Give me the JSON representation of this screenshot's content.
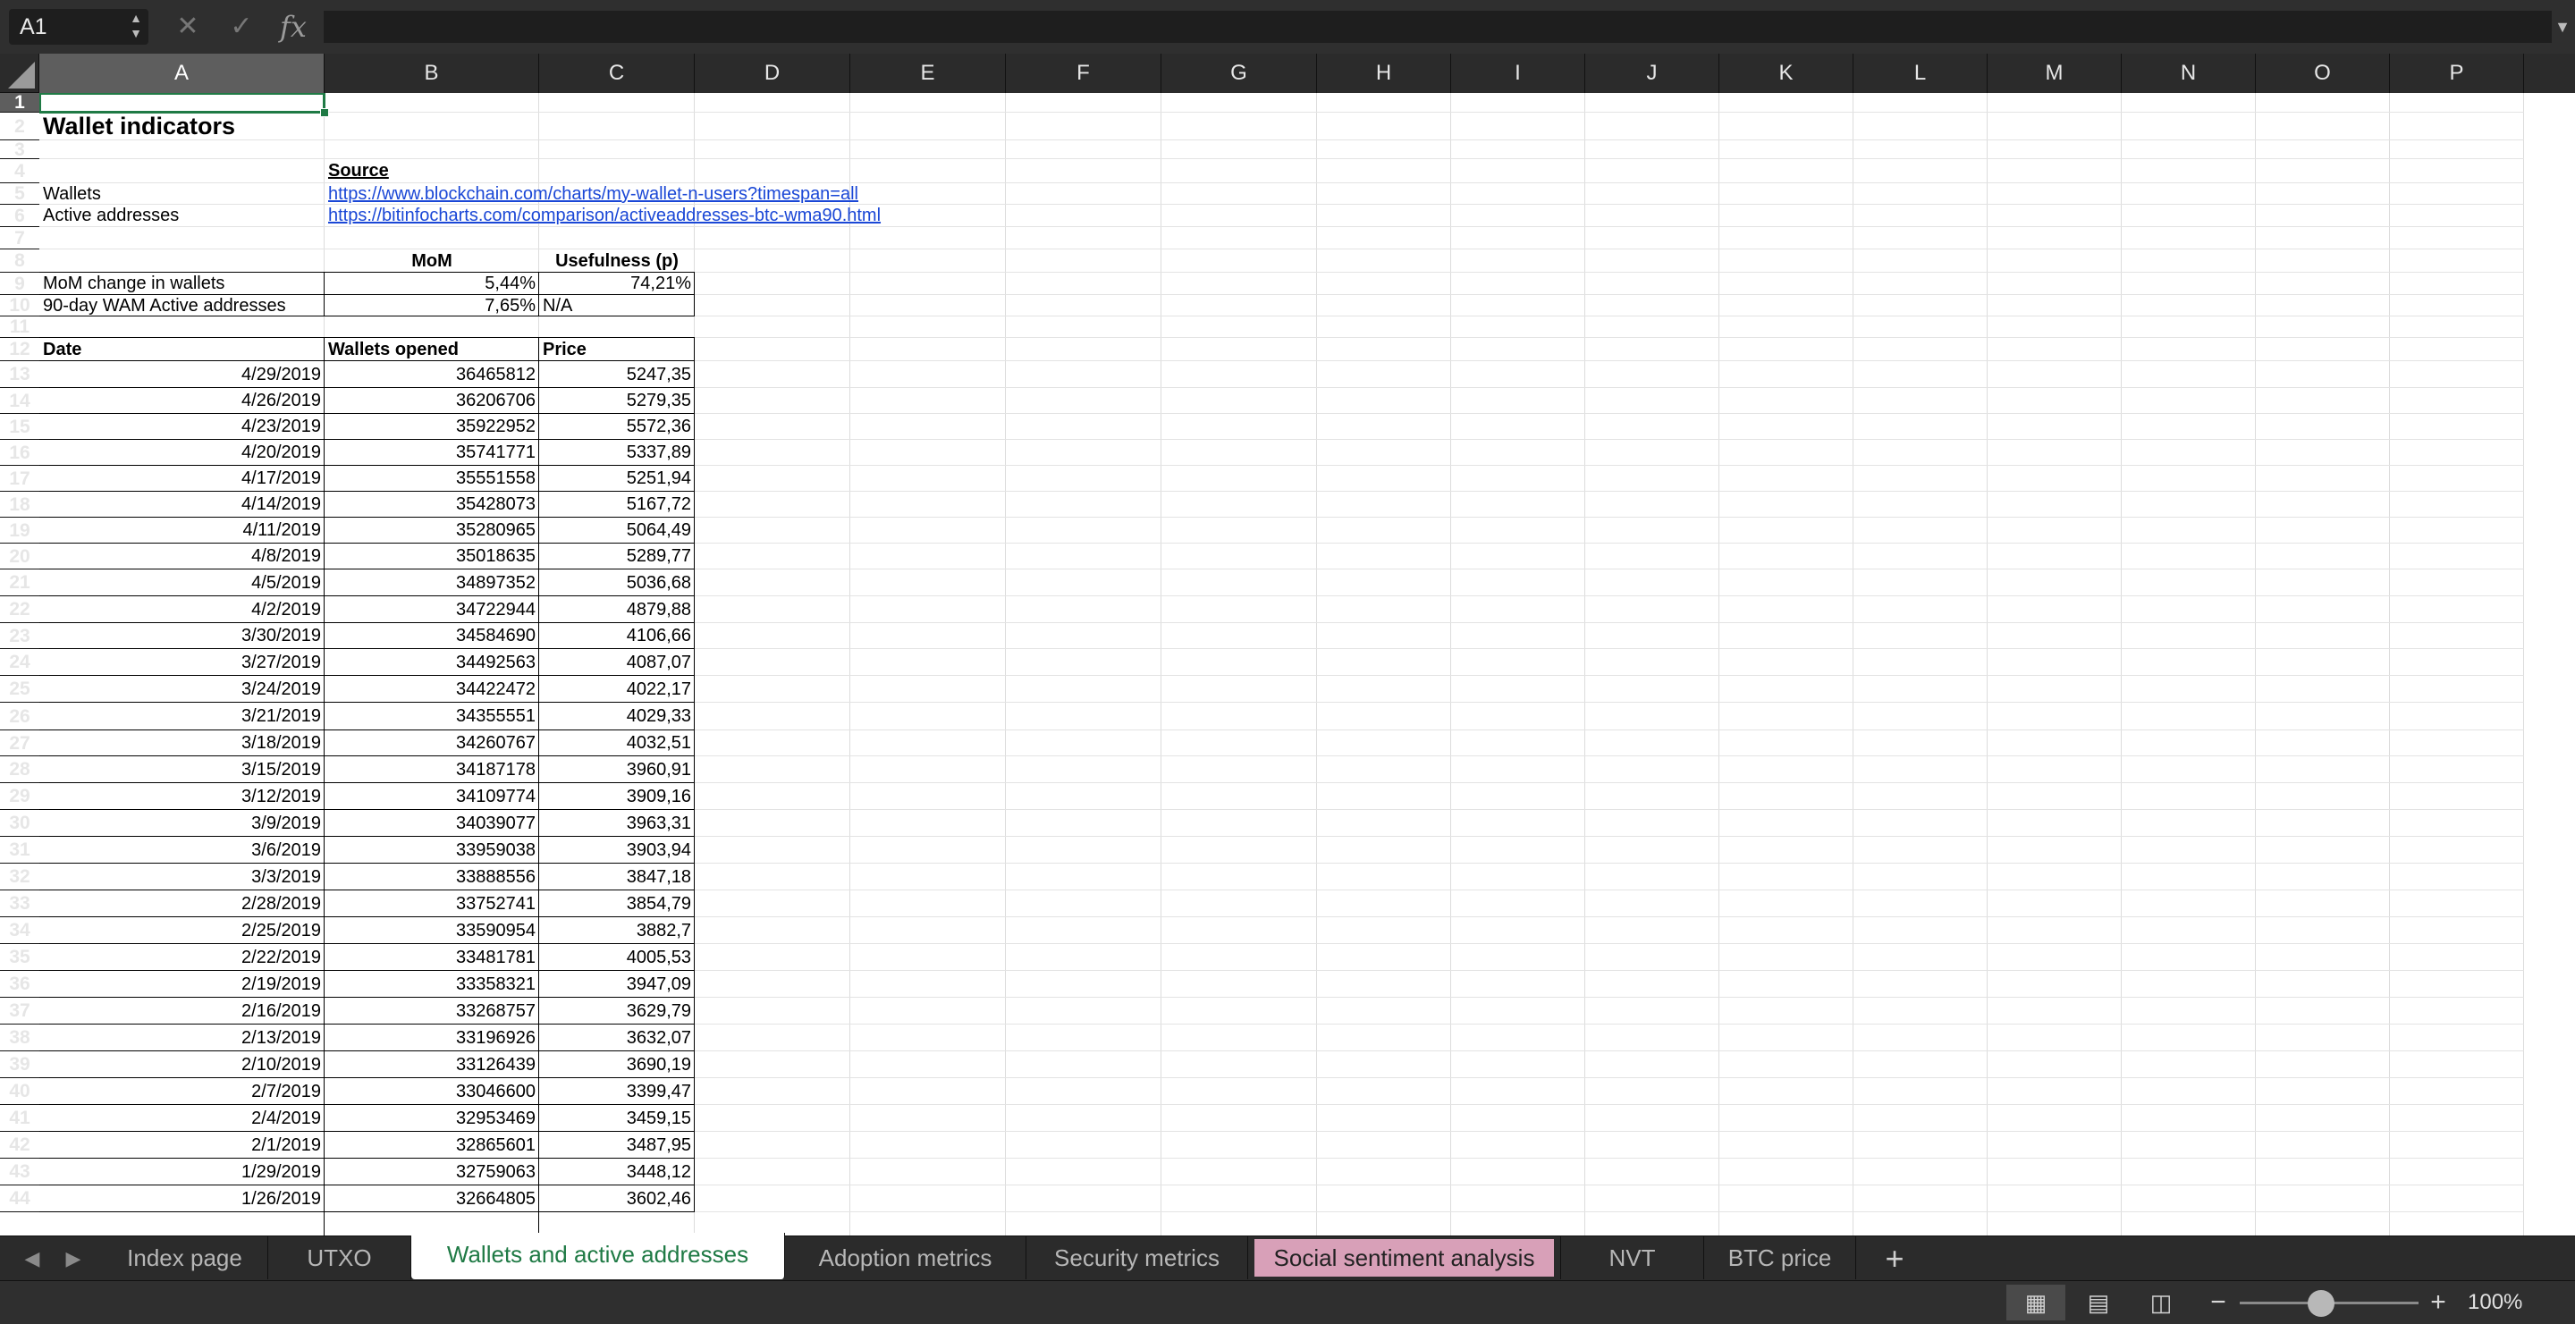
{
  "formula_bar": {
    "name_box": "A1",
    "cancel_glyph": "✕",
    "confirm_glyph": "✓",
    "fx_label": "fx",
    "formula_value": ""
  },
  "columns": [
    "A",
    "B",
    "C",
    "D",
    "E",
    "F",
    "G",
    "H",
    "I",
    "J",
    "K",
    "L",
    "M",
    "N",
    "O",
    "P"
  ],
  "row_count": 44,
  "selected": {
    "column": "A",
    "row": 1
  },
  "sheet": {
    "title": "Wallet indicators",
    "source_header": "Source",
    "sources": [
      {
        "label": "Wallets",
        "url": "https://www.blockchain.com/charts/my-wallet-n-users?timespan=all"
      },
      {
        "label": "Active addresses",
        "url": "https://bitinfocharts.com/comparison/activeaddresses-btc-wma90.html"
      }
    ],
    "summary": {
      "headers": [
        "MoM",
        "Usefulness (p)"
      ],
      "rows": [
        {
          "label": "MoM change in wallets",
          "mom": "5,44%",
          "usefulness": "74,21%"
        },
        {
          "label": "90-day WAM Active addresses",
          "mom": "7,65%",
          "usefulness": "N/A"
        }
      ]
    },
    "table": {
      "headers": [
        "Date",
        "Wallets opened",
        "Price"
      ],
      "rows": [
        [
          "4/29/2019",
          "36465812",
          "5247,35"
        ],
        [
          "4/26/2019",
          "36206706",
          "5279,35"
        ],
        [
          "4/23/2019",
          "35922952",
          "5572,36"
        ],
        [
          "4/20/2019",
          "35741771",
          "5337,89"
        ],
        [
          "4/17/2019",
          "35551558",
          "5251,94"
        ],
        [
          "4/14/2019",
          "35428073",
          "5167,72"
        ],
        [
          "4/11/2019",
          "35280965",
          "5064,49"
        ],
        [
          "4/8/2019",
          "35018635",
          "5289,77"
        ],
        [
          "4/5/2019",
          "34897352",
          "5036,68"
        ],
        [
          "4/2/2019",
          "34722944",
          "4879,88"
        ],
        [
          "3/30/2019",
          "34584690",
          "4106,66"
        ],
        [
          "3/27/2019",
          "34492563",
          "4087,07"
        ],
        [
          "3/24/2019",
          "34422472",
          "4022,17"
        ],
        [
          "3/21/2019",
          "34355551",
          "4029,33"
        ],
        [
          "3/18/2019",
          "34260767",
          "4032,51"
        ],
        [
          "3/15/2019",
          "34187178",
          "3960,91"
        ],
        [
          "3/12/2019",
          "34109774",
          "3909,16"
        ],
        [
          "3/9/2019",
          "34039077",
          "3963,31"
        ],
        [
          "3/6/2019",
          "33959038",
          "3903,94"
        ],
        [
          "3/3/2019",
          "33888556",
          "3847,18"
        ],
        [
          "2/28/2019",
          "33752741",
          "3854,79"
        ],
        [
          "2/25/2019",
          "33590954",
          "3882,7"
        ],
        [
          "2/22/2019",
          "33481781",
          "4005,53"
        ],
        [
          "2/19/2019",
          "33358321",
          "3947,09"
        ],
        [
          "2/16/2019",
          "33268757",
          "3629,79"
        ],
        [
          "2/13/2019",
          "33196926",
          "3632,07"
        ],
        [
          "2/10/2019",
          "33126439",
          "3690,19"
        ],
        [
          "2/7/2019",
          "33046600",
          "3399,47"
        ],
        [
          "2/4/2019",
          "32953469",
          "3459,15"
        ],
        [
          "2/1/2019",
          "32865601",
          "3487,95"
        ],
        [
          "1/29/2019",
          "32759063",
          "3448,12"
        ],
        [
          "1/26/2019",
          "32664805",
          "3602,46"
        ]
      ]
    }
  },
  "tabs": [
    {
      "label": "Index page",
      "state": "normal"
    },
    {
      "label": "UTXO",
      "state": "normal"
    },
    {
      "label": "Wallets and active addresses",
      "state": "active"
    },
    {
      "label": "Adoption metrics",
      "state": "normal"
    },
    {
      "label": "Security metrics",
      "state": "normal"
    },
    {
      "label": "Social sentiment analysis",
      "state": "highlighted"
    },
    {
      "label": "NVT",
      "state": "normal"
    },
    {
      "label": "BTC price",
      "state": "normal"
    }
  ],
  "tab_nav": {
    "prev": "◀",
    "next": "▶",
    "add": "+"
  },
  "status": {
    "zoom": "100%",
    "zoom_level": 0.55,
    "zoom_minus": "−",
    "zoom_plus": "+"
  },
  "colors": {
    "accent": "#1f7a45",
    "link": "#1a47d6",
    "highlight_tab": "#d8a0b8"
  }
}
